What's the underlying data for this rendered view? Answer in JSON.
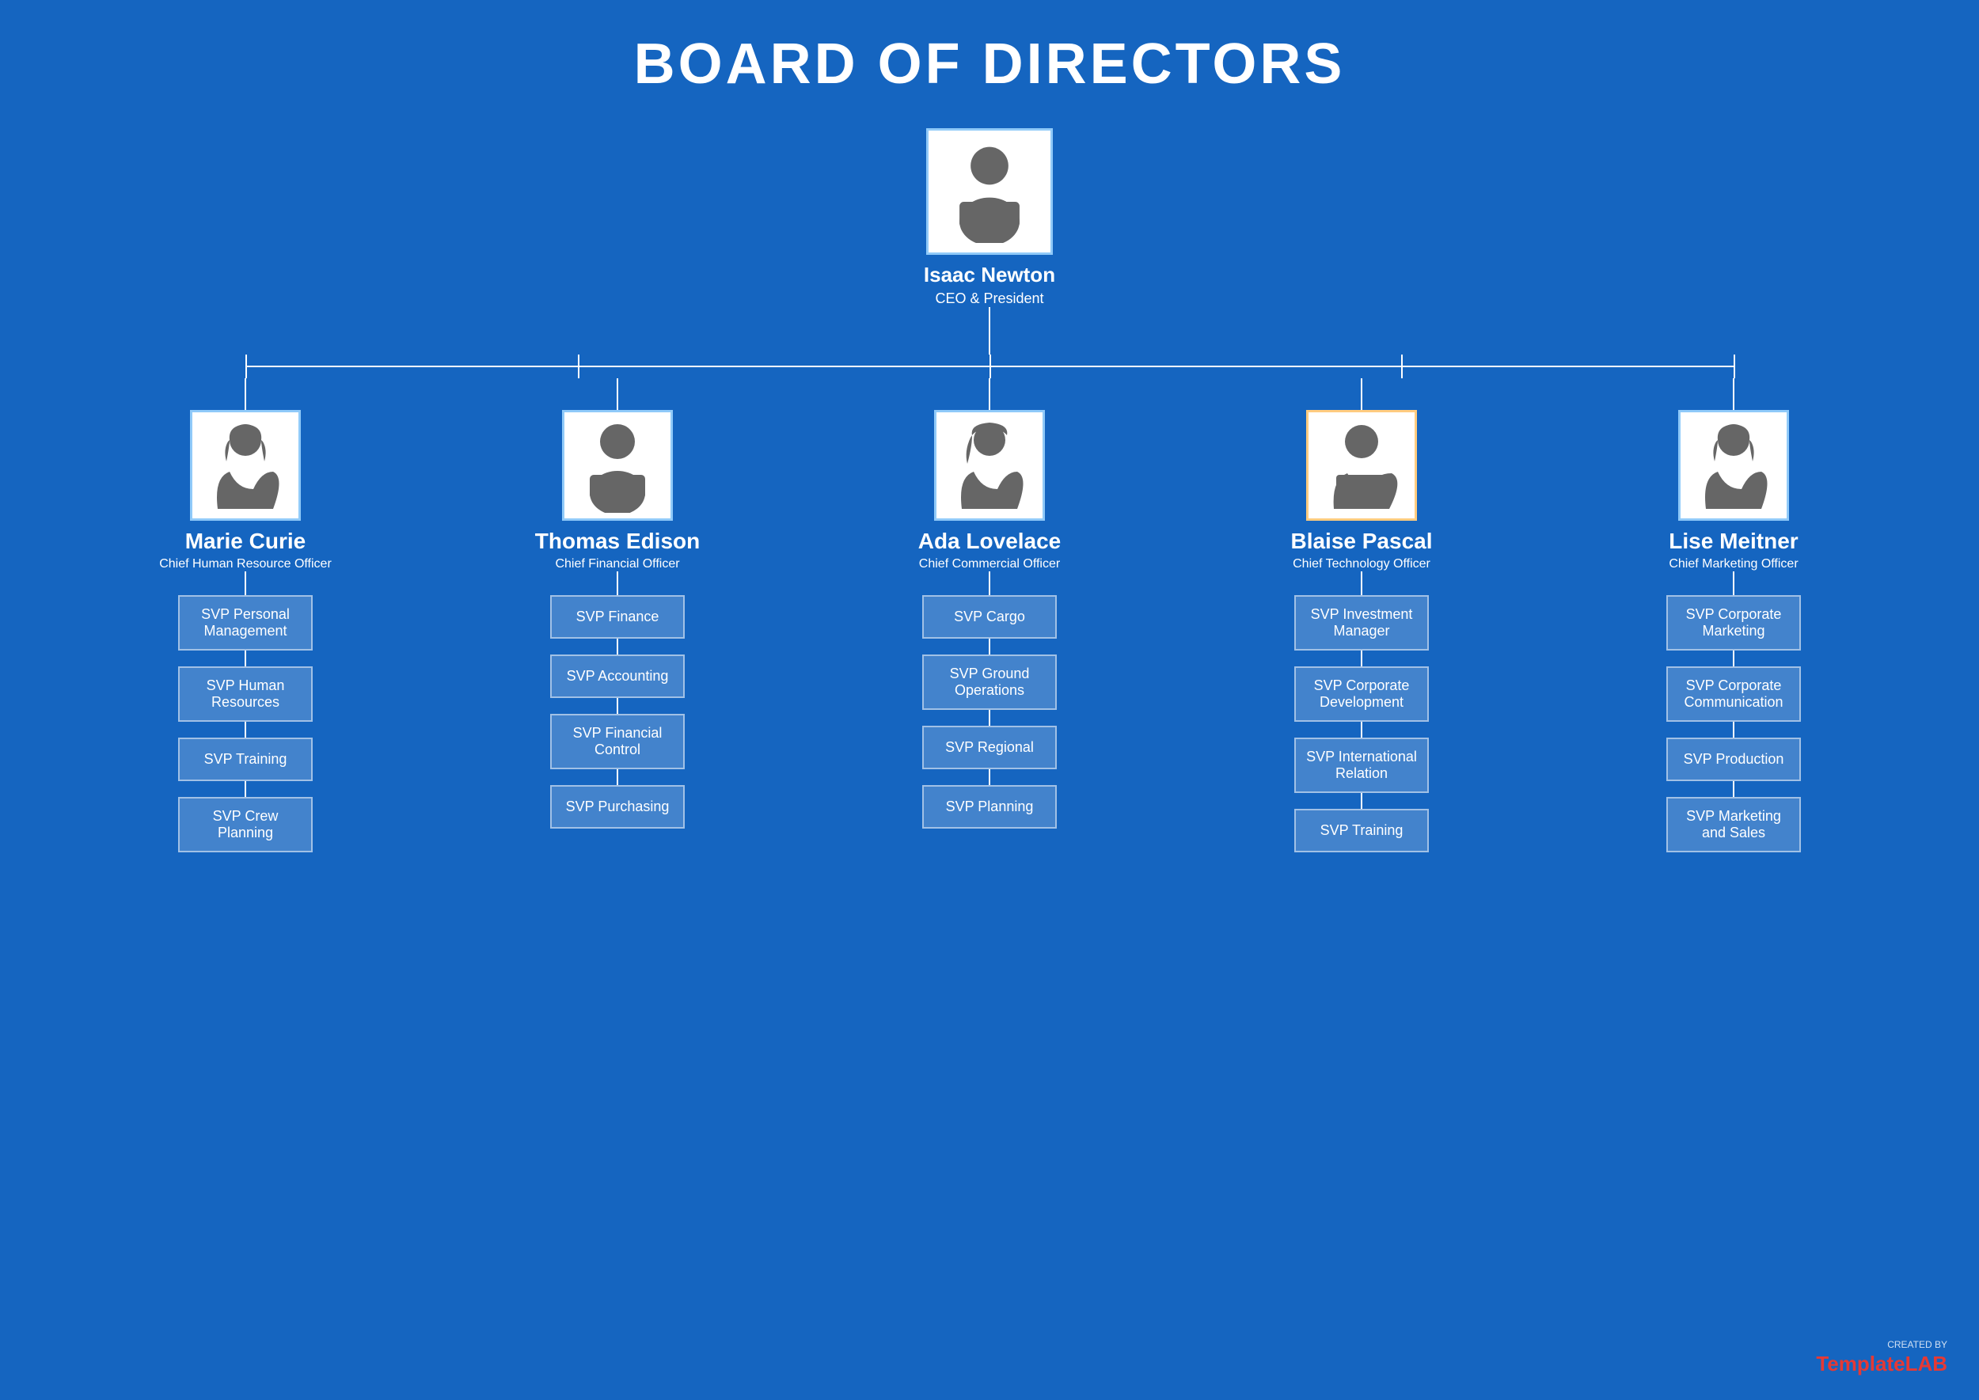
{
  "title": "BOARD OF DIRECTORS",
  "ceo": {
    "name": "Isaac Newton",
    "role": "CEO & President"
  },
  "directors": [
    {
      "name": "Marie Curie",
      "role": "Chief Human Resource Officer",
      "gender": "female",
      "svps": [
        "SVP Personal Management",
        "SVP Human Resources",
        "SVP Training",
        "SVP Crew Planning"
      ]
    },
    {
      "name": "Thomas Edison",
      "role": "Chief Financial Officer",
      "gender": "male",
      "svps": [
        "SVP Finance",
        "SVP Accounting",
        "SVP Financial Control",
        "SVP Purchasing"
      ]
    },
    {
      "name": "Ada Lovelace",
      "role": "Chief Commercial Officer",
      "gender": "female2",
      "svps": [
        "SVP Cargo",
        "SVP Ground Operations",
        "SVP Regional",
        "SVP Planning"
      ]
    },
    {
      "name": "Blaise Pascal",
      "role": "Chief Technology Officer",
      "gender": "male2",
      "svps": [
        "SVP Investment Manager",
        "SVP Corporate Development",
        "SVP International Relation",
        "SVP Training"
      ]
    },
    {
      "name": "Lise Meitner",
      "role": "Chief Marketing Officer",
      "gender": "female",
      "svps": [
        "SVP Corporate Marketing",
        "SVP Corporate Communication",
        "SVP Production",
        "SVP Marketing and Sales"
      ]
    }
  ],
  "logo": {
    "created_by": "CREATED BY",
    "brand_normal": "Template",
    "brand_bold": "LAB"
  }
}
